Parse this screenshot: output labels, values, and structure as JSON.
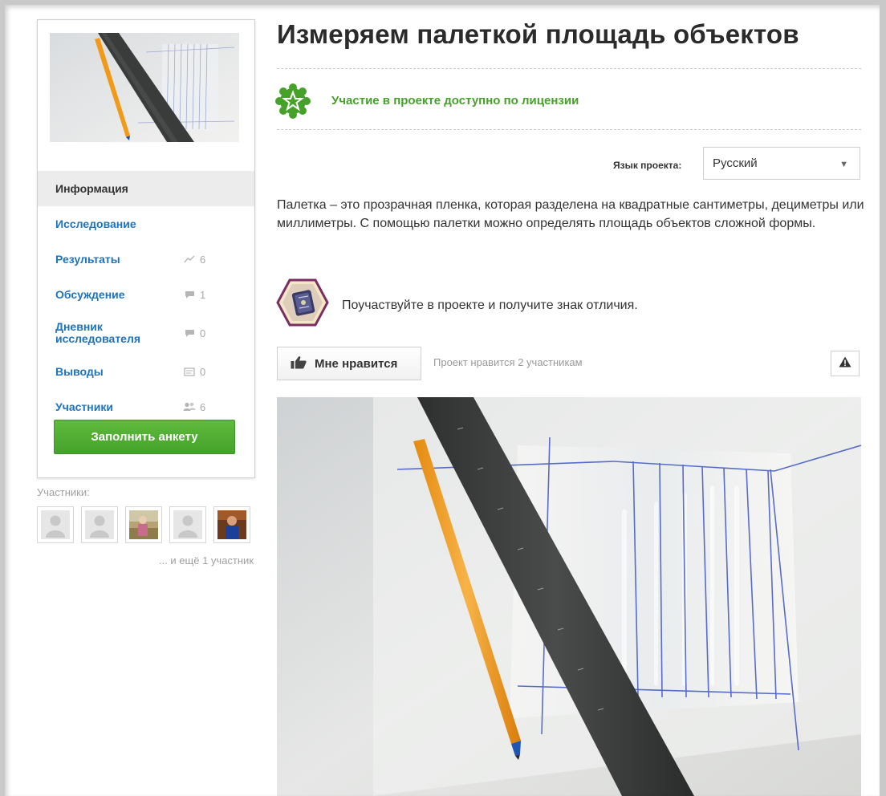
{
  "project": {
    "title": "Измеряем палеткой площадь объектов",
    "license_text": "Участие в проекте доступно по лицензии",
    "language_label": "Язык проекта:",
    "language_value": "Русский",
    "description": "Палетка – это прозрачная пленка, которая разделена на квадратные сантиметры, дециметры или миллиметры. С помощью палетки можно определять площадь объектов сложной формы.",
    "badge_text": "Поучаствуйте в проекте и получите знак отличия.",
    "like_label": "Мне нравится",
    "like_count_text": "Проект нравится 2 участникам"
  },
  "sidebar": {
    "items": [
      {
        "label": "Информация",
        "count": null,
        "icon": "none",
        "active": true
      },
      {
        "label": "Исследование",
        "count": null,
        "icon": "none",
        "active": false
      },
      {
        "label": "Результаты",
        "count": "6",
        "icon": "chart-line-icon",
        "active": false
      },
      {
        "label": "Обсуждение",
        "count": "1",
        "icon": "comment-icon",
        "active": false
      },
      {
        "label": "Дневник исследователя",
        "count": "0",
        "icon": "comment-icon",
        "active": false
      },
      {
        "label": "Выводы",
        "count": "0",
        "icon": "note-icon",
        "active": false
      },
      {
        "label": "Участники",
        "count": "6",
        "icon": "people-icon",
        "active": false
      }
    ],
    "cta_label": "Заполнить анкету"
  },
  "members": {
    "label": "Участники:",
    "more_text": "... и ещё 1 участник",
    "avatars": [
      "default",
      "default",
      "photo",
      "default",
      "photo"
    ]
  },
  "colors": {
    "link": "#1e73be",
    "green": "#46a12a",
    "button_green": "#52ae33"
  }
}
